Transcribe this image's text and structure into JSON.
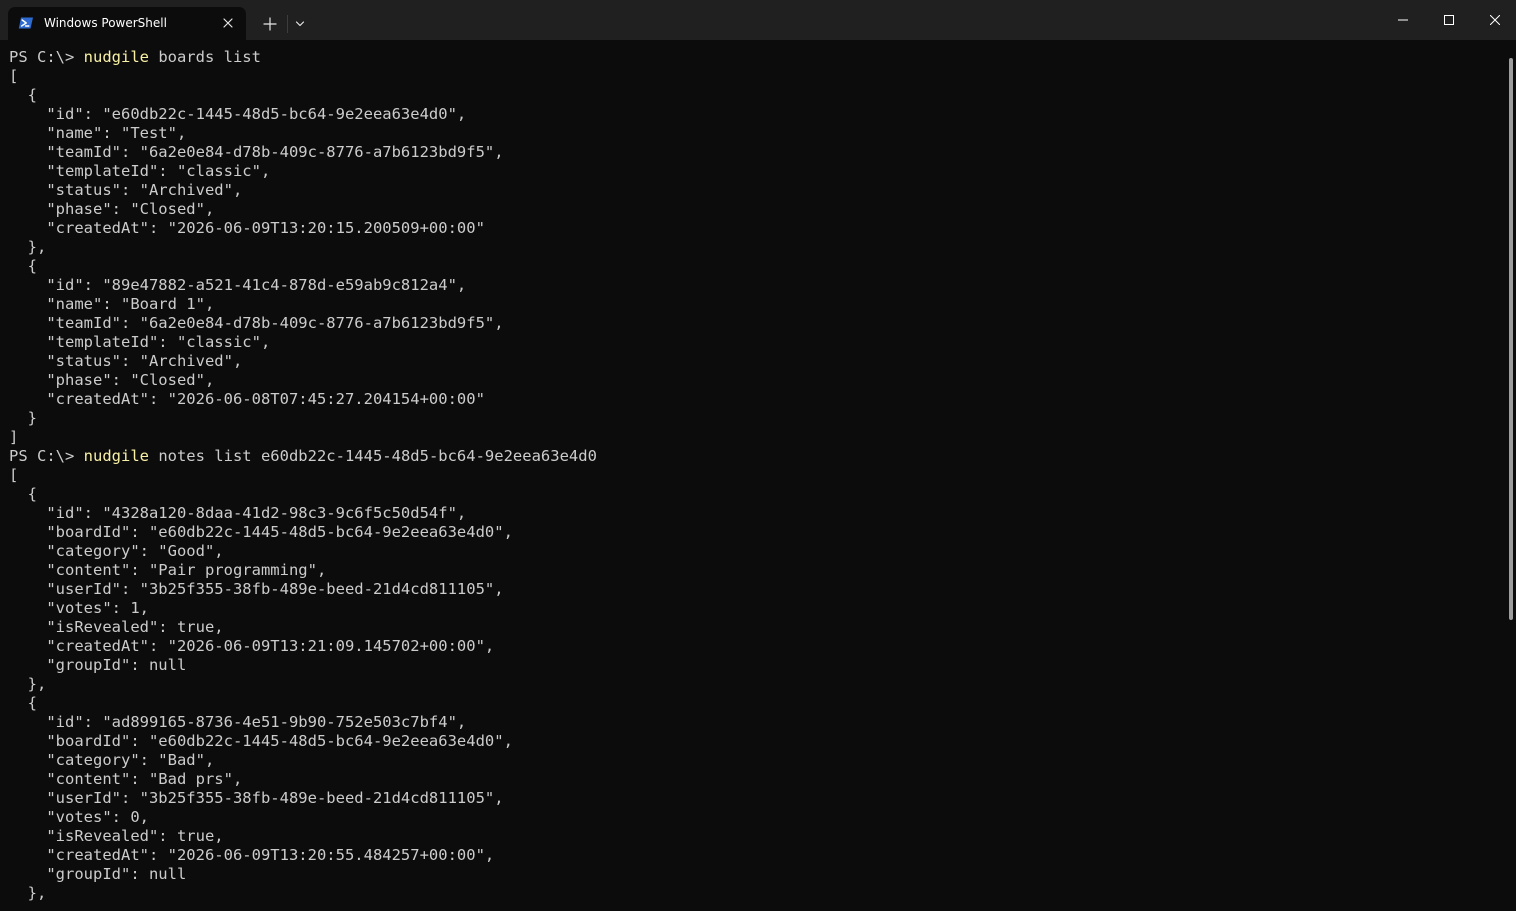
{
  "window": {
    "tab_title": "Windows PowerShell",
    "tab_icon": "powershell-icon"
  },
  "titlebar_buttons": {
    "new_tab_icon": "plus-icon",
    "dropdown_icon": "chevron-down-icon",
    "minimize_icon": "minimize-icon",
    "maximize_icon": "maximize-icon",
    "close_icon": "close-icon"
  },
  "colors": {
    "background": "#0c0c0c",
    "titlebar": "#202020",
    "text": "#cccccc",
    "command": "#f9f1a5"
  },
  "terminal": {
    "blocks": [
      {
        "prompt": "PS C:\\> ",
        "command": "nudgile",
        "args": " boards list",
        "output": [
          "[",
          "  {",
          "    \"id\": \"e60db22c-1445-48d5-bc64-9e2eea63e4d0\",",
          "    \"name\": \"Test\",",
          "    \"teamId\": \"6a2e0e84-d78b-409c-8776-a7b6123bd9f5\",",
          "    \"templateId\": \"classic\",",
          "    \"status\": \"Archived\",",
          "    \"phase\": \"Closed\",",
          "    \"createdAt\": \"2026-06-09T13:20:15.200509+00:00\"",
          "  },",
          "  {",
          "    \"id\": \"89e47882-a521-41c4-878d-e59ab9c812a4\",",
          "    \"name\": \"Board 1\",",
          "    \"teamId\": \"6a2e0e84-d78b-409c-8776-a7b6123bd9f5\",",
          "    \"templateId\": \"classic\",",
          "    \"status\": \"Archived\",",
          "    \"phase\": \"Closed\",",
          "    \"createdAt\": \"2026-06-08T07:45:27.204154+00:00\"",
          "  }",
          "]"
        ]
      },
      {
        "prompt": "PS C:\\> ",
        "command": "nudgile",
        "args": " notes list e60db22c-1445-48d5-bc64-9e2eea63e4d0",
        "output": [
          "[",
          "  {",
          "    \"id\": \"4328a120-8daa-41d2-98c3-9c6f5c50d54f\",",
          "    \"boardId\": \"e60db22c-1445-48d5-bc64-9e2eea63e4d0\",",
          "    \"category\": \"Good\",",
          "    \"content\": \"Pair programming\",",
          "    \"userId\": \"3b25f355-38fb-489e-beed-21d4cd811105\",",
          "    \"votes\": 1,",
          "    \"isRevealed\": true,",
          "    \"createdAt\": \"2026-06-09T13:21:09.145702+00:00\",",
          "    \"groupId\": null",
          "  },",
          "  {",
          "    \"id\": \"ad899165-8736-4e51-9b90-752e503c7bf4\",",
          "    \"boardId\": \"e60db22c-1445-48d5-bc64-9e2eea63e4d0\",",
          "    \"category\": \"Bad\",",
          "    \"content\": \"Bad prs\",",
          "    \"userId\": \"3b25f355-38fb-489e-beed-21d4cd811105\",",
          "    \"votes\": 0,",
          "    \"isRevealed\": true,",
          "    \"createdAt\": \"2026-06-09T13:20:55.484257+00:00\",",
          "    \"groupId\": null",
          "  },"
        ]
      }
    ]
  }
}
